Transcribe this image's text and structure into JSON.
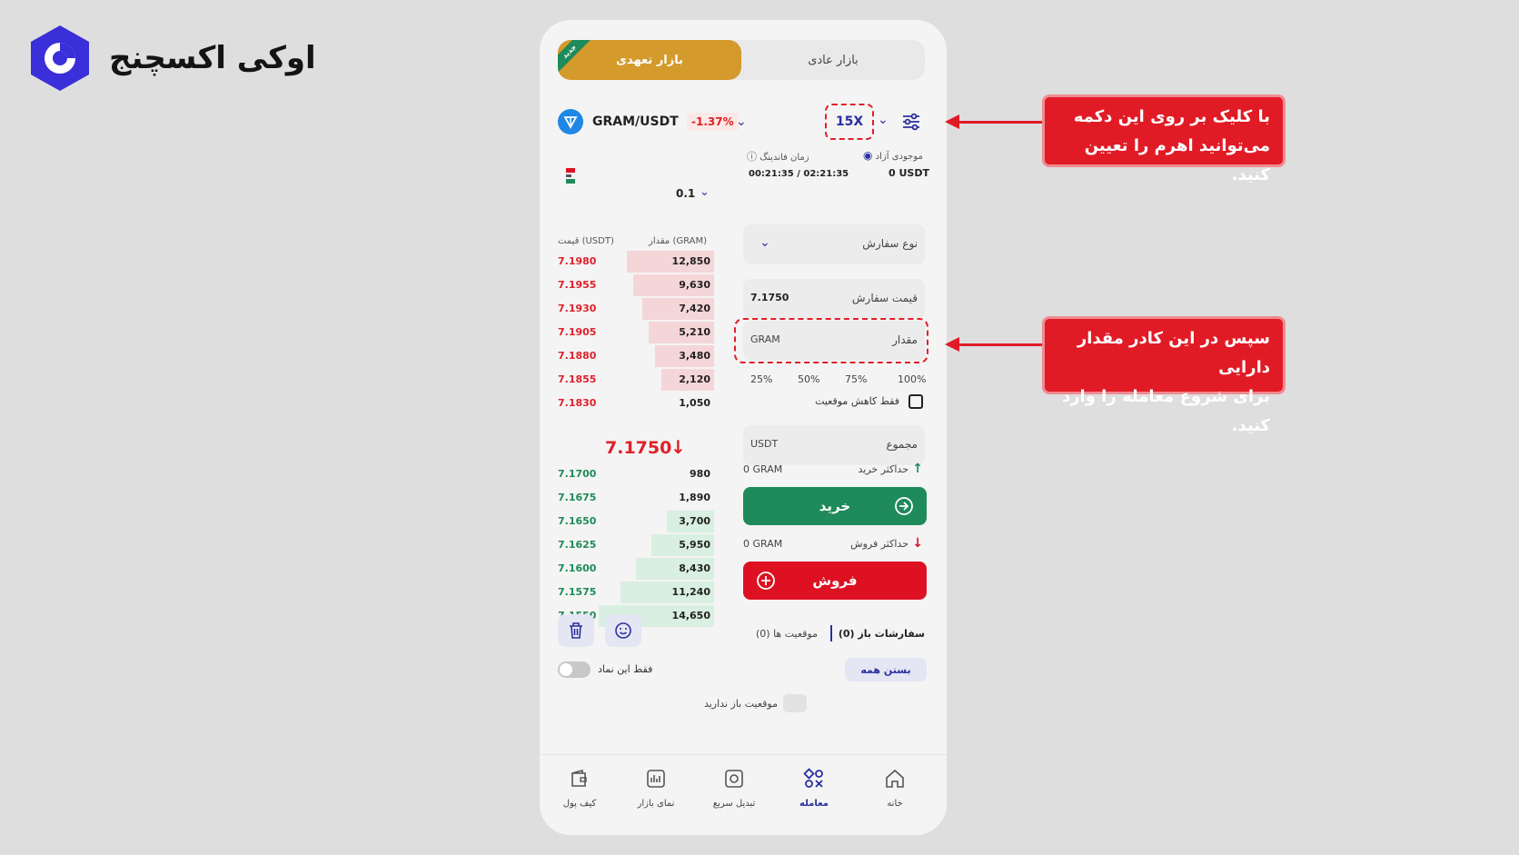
{
  "brand": {
    "name": "اوکی اکسچنج",
    "color": "#3a2fd8"
  },
  "tabs": {
    "futures": "بازار تعهدی",
    "spot": "بازار عادی",
    "badge": "جدید"
  },
  "pair": {
    "name": "GRAM/USDT",
    "change": "-1.37%",
    "leverage": "15X"
  },
  "balance": {
    "free_label": "موجودی آزاد",
    "free_value": "0 USDT",
    "funding_label": "زمان فاندینگ",
    "funding_value": "00:21:35 / 02:21:35"
  },
  "tick": "0.1",
  "orderbook": {
    "qty_header": "مقدار (GRAM)",
    "price_header": "قیمت (USDT)",
    "asks": [
      {
        "price": "7.1980",
        "qty": "12,850",
        "depth": 0.56
      },
      {
        "price": "7.1955",
        "qty": "9,630",
        "depth": 0.52
      },
      {
        "price": "7.1930",
        "qty": "7,420",
        "depth": 0.46
      },
      {
        "price": "7.1905",
        "qty": "5,210",
        "depth": 0.42
      },
      {
        "price": "7.1880",
        "qty": "3,480",
        "depth": 0.38
      },
      {
        "price": "7.1855",
        "qty": "2,120",
        "depth": 0.34
      },
      {
        "price": "7.1830",
        "qty": "1,050",
        "depth": 0.0
      }
    ],
    "mid_price": "7.1750",
    "bids": [
      {
        "price": "7.1700",
        "qty": "980",
        "depth": 0.0
      },
      {
        "price": "7.1675",
        "qty": "1,890",
        "depth": 0.0
      },
      {
        "price": "7.1650",
        "qty": "3,700",
        "depth": 0.3
      },
      {
        "price": "7.1625",
        "qty": "5,950",
        "depth": 0.4
      },
      {
        "price": "7.1600",
        "qty": "8,430",
        "depth": 0.5
      },
      {
        "price": "7.1575",
        "qty": "11,240",
        "depth": 0.6
      },
      {
        "price": "7.1550",
        "qty": "14,650",
        "depth": 0.74
      }
    ]
  },
  "form": {
    "order_type_label": "نوع سفارش",
    "order_price_label": "قیمت سفارش",
    "order_price_value": "7.1750",
    "qty_label": "مقدار",
    "qty_unit": "GRAM",
    "pcts": [
      "25%",
      "50%",
      "75%",
      "100%"
    ],
    "reduce_only": "فقط کاهش موقعیت",
    "total_label": "مجموع",
    "total_unit": "USDT",
    "max_buy_label": "حداکثر خرید",
    "max_buy_value": "0 GRAM",
    "buy": "خرید",
    "max_sell_label": "حداکثر فروش",
    "max_sell_value": "0 GRAM",
    "sell": "فروش"
  },
  "orders": {
    "open_orders": "سفارشات باز (0)",
    "positions": "موقعیت ها (0)",
    "only_symbol": "فقط این نماد",
    "close_all": "بستن همه",
    "empty": "موقعیت باز ندارید"
  },
  "nav": [
    {
      "label": "خانه",
      "icon": "home-icon"
    },
    {
      "label": "معامله",
      "icon": "trade-icon"
    },
    {
      "label": "تبدیل سریع",
      "icon": "convert-icon"
    },
    {
      "label": "نمای بازار",
      "icon": "market-icon"
    },
    {
      "label": "کیف پول",
      "icon": "wallet-icon"
    }
  ],
  "callouts": {
    "leverage_line1": "با کلیک بر روی این دکمه",
    "leverage_line2": "می‌توانید اهرم را تعیین کنید.",
    "qty_line1": "سپس در این کادر مقدار دارایی",
    "qty_line2": "برای شروع معامله را وارد کنید."
  },
  "colors": {
    "buy": "#1f8a5a",
    "sell": "#dd1122",
    "accent": "#2b2fa0",
    "gold": "#d49a2c",
    "callout": "#e11b26"
  }
}
